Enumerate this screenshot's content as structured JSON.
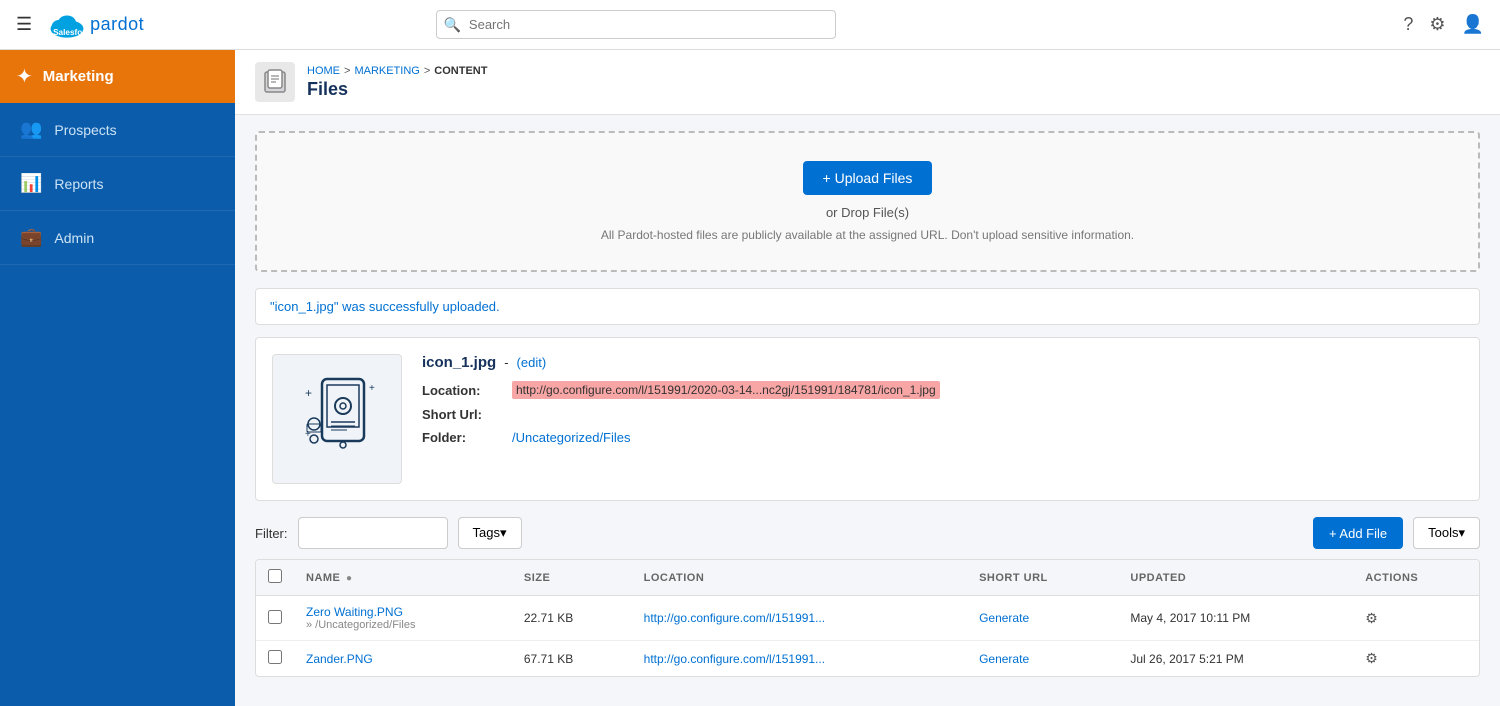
{
  "topnav": {
    "search_placeholder": "Search",
    "hamburger_label": "☰",
    "logo_text": "pardot",
    "help_icon": "?",
    "settings_icon": "⚙",
    "user_icon": "👤"
  },
  "sidebar": {
    "active_item": "Marketing",
    "active_icon": "✦",
    "items": [
      {
        "id": "marketing",
        "label": "Marketing",
        "icon": "✦"
      },
      {
        "id": "prospects",
        "label": "Prospects",
        "icon": "👥"
      },
      {
        "id": "reports",
        "label": "Reports",
        "icon": "📊"
      },
      {
        "id": "admin",
        "label": "Admin",
        "icon": "💼"
      }
    ]
  },
  "breadcrumb": {
    "home": "HOME",
    "sep1": ">",
    "marketing": "MARKETING",
    "sep2": ">",
    "content": "CONTENT"
  },
  "page": {
    "title": "Files"
  },
  "dropzone": {
    "upload_btn_label": "+ Upload Files",
    "or_drop": "or Drop File(s)",
    "note": "All Pardot-hosted files are publicly available at the assigned URL. Don't upload sensitive information."
  },
  "success_banner": {
    "message": "\"icon_1.jpg\" was successfully uploaded."
  },
  "file_card": {
    "name": "icon_1.jpg",
    "dash": "-",
    "edit_label": "(edit)",
    "location_label": "Location:",
    "location_url": "http://go.configure.com/l/151991/2020-03-14...nc2gj/151991/184781/icon_1.jpg",
    "location_url_partial": "nc2gj/151991/184781/icon_1.jpg",
    "short_url_label": "Short Url:",
    "short_url_value": "",
    "folder_label": "Folder:",
    "folder_path": "/Uncategorized/Files"
  },
  "filter_bar": {
    "filter_label": "Filter:",
    "filter_placeholder": "",
    "tags_btn_label": "Tags▾",
    "add_file_btn_label": "+ Add File",
    "tools_btn_label": "Tools▾"
  },
  "table": {
    "columns": [
      "",
      "NAME ●",
      "SIZE",
      "LOCATION",
      "SHORT URL",
      "UPDATED",
      "ACTIONS"
    ],
    "rows": [
      {
        "checked": false,
        "name": "Zero Waiting.PNG",
        "subfolder": "» /Uncategorized/Files",
        "size": "22.71 KB",
        "location": "http://go.configure.com/l/151991...",
        "short_url": "Generate",
        "updated": "May 4, 2017 10:11 PM",
        "actions": "⚙"
      },
      {
        "checked": false,
        "name": "Zander.PNG",
        "subfolder": "",
        "size": "67.71 KB",
        "location": "http://go.configure.com/l/151991...",
        "short_url": "Generate",
        "updated": "Jul 26, 2017 5:21 PM",
        "actions": "⚙"
      }
    ]
  }
}
